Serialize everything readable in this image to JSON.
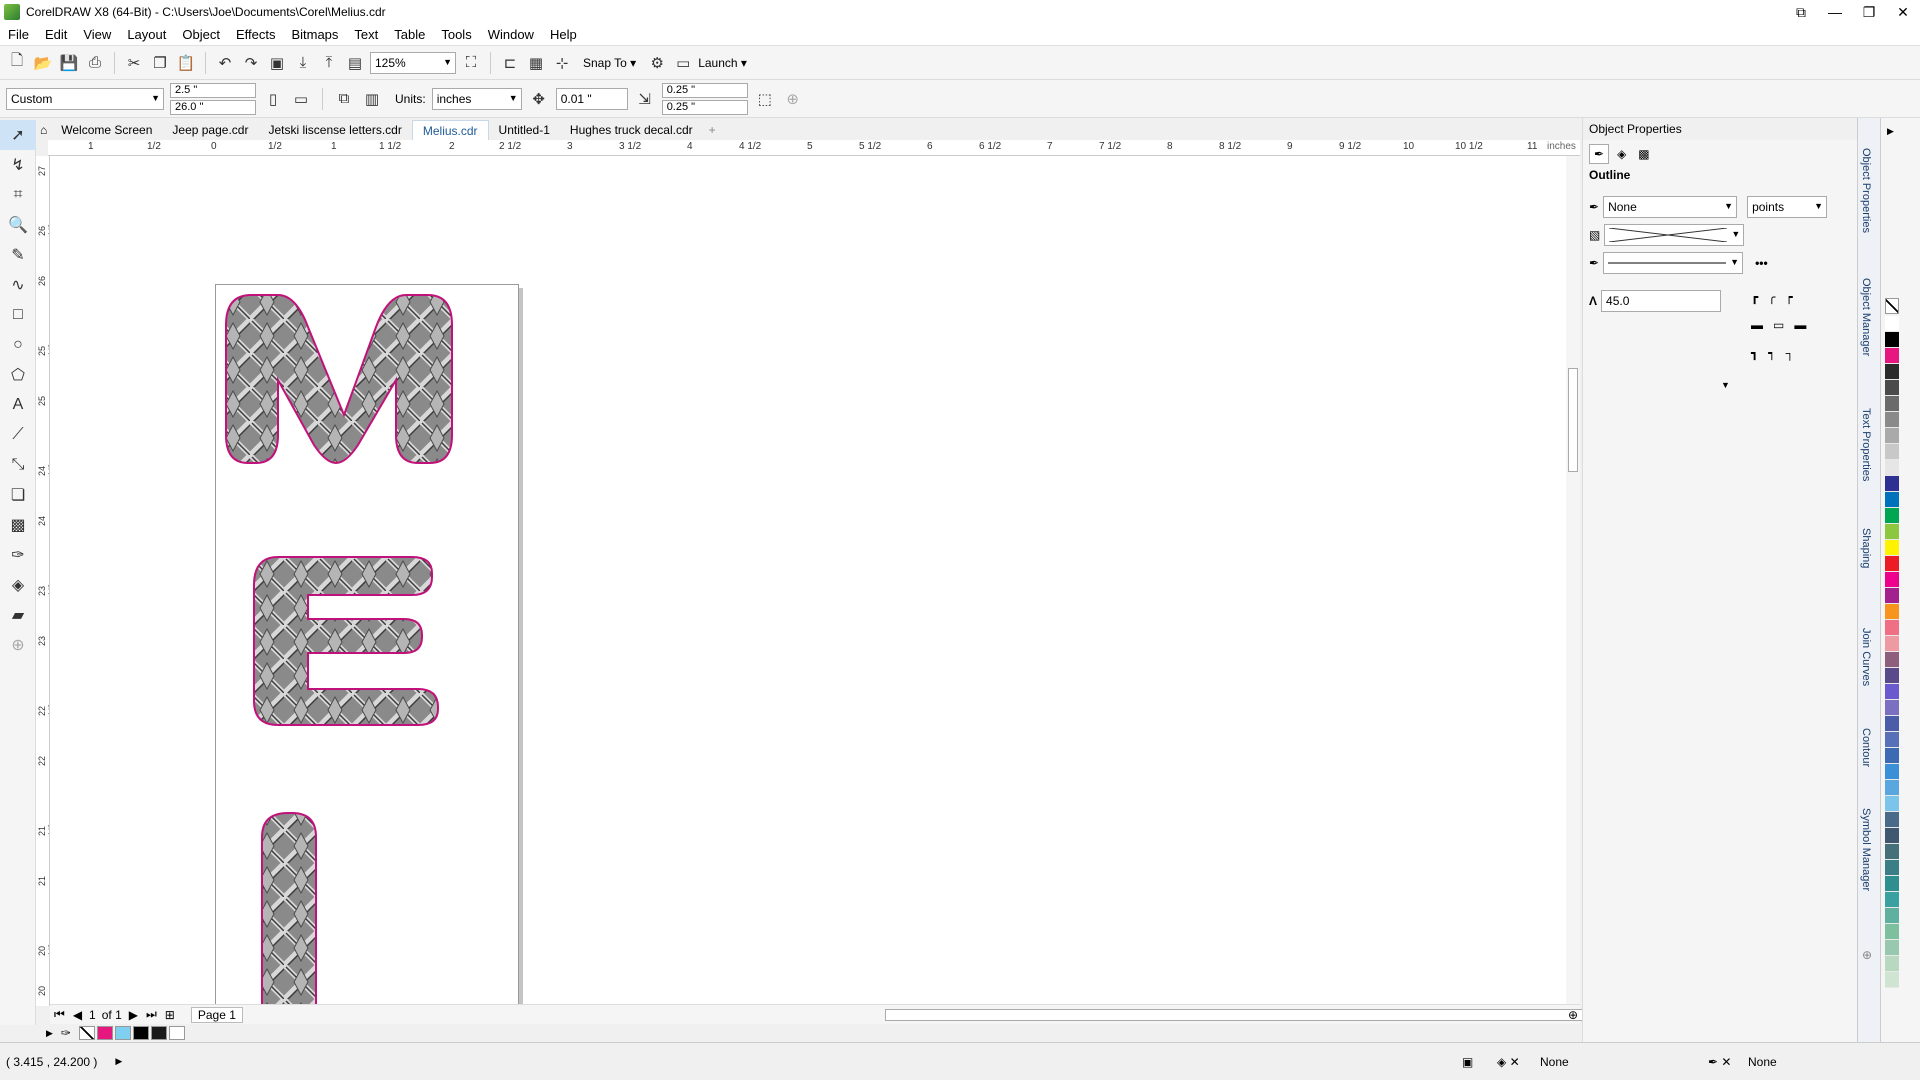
{
  "window": {
    "title": "CorelDRAW X8 (64-Bit) - C:\\Users\\Joe\\Documents\\Corel\\Melius.cdr",
    "controls": [
      "⧉",
      "—",
      "❐",
      "✕"
    ]
  },
  "menubar": {
    "items": [
      "File",
      "Edit",
      "View",
      "Layout",
      "Object",
      "Effects",
      "Bitmaps",
      "Text",
      "Table",
      "Tools",
      "Window",
      "Help"
    ]
  },
  "toolbar": {
    "zoom": "125%",
    "snap_to": "Snap To",
    "launch": "Launch"
  },
  "propbar": {
    "page_preset": "Custom",
    "width": "2.5 \"",
    "height": "26.0 \"",
    "units_label": "Units:",
    "units": "inches",
    "nudge": "0.01 \"",
    "dup_x": "0.25 \"",
    "dup_y": "0.25 \""
  },
  "tabs": [
    {
      "label": "Welcome Screen",
      "active": false
    },
    {
      "label": "Jeep page.cdr",
      "active": false
    },
    {
      "label": "Jetski liscense letters.cdr",
      "active": false
    },
    {
      "label": "Melius.cdr",
      "active": true
    },
    {
      "label": "Untitled-1",
      "active": false
    },
    {
      "label": "Hughes truck decal.cdr",
      "active": false
    }
  ],
  "ruler_h": {
    "unit": "inches",
    "labels": [
      "1",
      "1/2",
      "0",
      "1/2",
      "1",
      "1 1/2",
      "2",
      "2 1/2",
      "3",
      "3 1/2",
      "4",
      "4 1/2",
      "5",
      "5 1/2",
      "6",
      "6 1/2",
      "7",
      "7 1/2",
      "8",
      "8 1/2",
      "9",
      "9 1/2",
      "10",
      "10 1/2",
      "11"
    ]
  },
  "ruler_v": {
    "labels": [
      "27",
      "26 1/2",
      "26",
      "25 1/2",
      "25",
      "24 1/2",
      "24",
      "23 1/2",
      "23",
      "22 1/2",
      "22",
      "21 1/2",
      "21",
      "20 1/2",
      "20"
    ]
  },
  "artwork": {
    "letters": [
      "M",
      "E",
      "L"
    ],
    "fill": "diamond-plate",
    "outline_color": "#c0127a"
  },
  "page_nav": {
    "current": "1",
    "of_label": "of 1",
    "page_tab": "Page 1"
  },
  "status": {
    "coords": "( 3.415 , 24.200 )",
    "fill_value": "None",
    "outline_value": "None"
  },
  "object_properties": {
    "title": "Object Properties",
    "section": "Outline",
    "width_value": "None",
    "width_unit": "points",
    "miter_limit": "45.0"
  },
  "dockers": [
    "Object Properties",
    "Object Manager",
    "Text Properties",
    "Shaping",
    "Join Curves",
    "Contour",
    "Symbol Manager"
  ],
  "colors": {
    "accent": "#1e5a96",
    "palette": [
      "#ffffff",
      "#000000",
      "#e6187f",
      "#2b2b2b",
      "#4a4a4a",
      "#6a6a6a",
      "#8a8a8a",
      "#aaaaaa",
      "#c8c8c8",
      "#e6e6e6",
      "#2e3192",
      "#0072bc",
      "#00a651",
      "#8dc63f",
      "#fff200",
      "#ed1c24",
      "#ec008c",
      "#a3218e",
      "#f7941d",
      "#ef6f84",
      "#ee9aa3",
      "#8e5f7d",
      "#5a4a8a",
      "#6a5acd",
      "#7b6fbf",
      "#4b5da8",
      "#5870b8",
      "#3c6bb4",
      "#3b8fd6",
      "#5aa7e0",
      "#7cc4e9",
      "#4a6a8a",
      "#3f5870",
      "#45707a",
      "#3a7f85",
      "#2f8f8f",
      "#3aa0a0",
      "#60b0a0",
      "#7cc0a0",
      "#98c8b0",
      "#b8d8c0",
      "#d0e4d4"
    ]
  }
}
